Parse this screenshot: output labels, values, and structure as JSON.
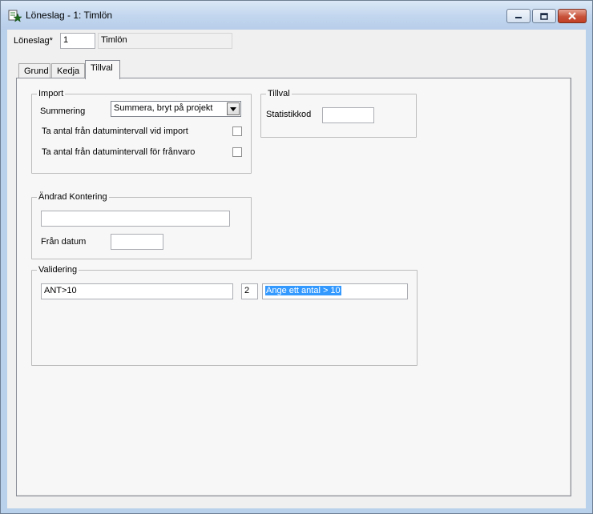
{
  "window": {
    "title": "Löneslag - 1: Timlön",
    "controls": {
      "minimize": "minimize-icon",
      "maximize": "maximize-icon",
      "close": "close-icon"
    }
  },
  "header": {
    "loneslag_label": "Löneslag*",
    "loneslag_value": "1",
    "loneslag_name": "Timlön"
  },
  "tabs": [
    {
      "label": "Grund"
    },
    {
      "label": "Kedja"
    },
    {
      "label": "Tillval"
    }
  ],
  "import_group": {
    "title": "Import",
    "summering_label": "Summering",
    "summering_value": "Summera, bryt på projekt",
    "checkbox1_label": "Ta antal från datumintervall vid import",
    "checkbox2_label": "Ta antal från datumintervall för frånvaro"
  },
  "tillval_group": {
    "title": "Tillval",
    "statistikkod_label": "Statistikkod",
    "statistikkod_value": ""
  },
  "andrad_group": {
    "title": "Ändrad Kontering",
    "kontering_value": "",
    "fran_datum_label": "Från datum",
    "fran_datum_value": ""
  },
  "validering_group": {
    "title": "Validering",
    "expression": "ANT>10",
    "level": "2",
    "message": "Ange ett antal > 10"
  }
}
